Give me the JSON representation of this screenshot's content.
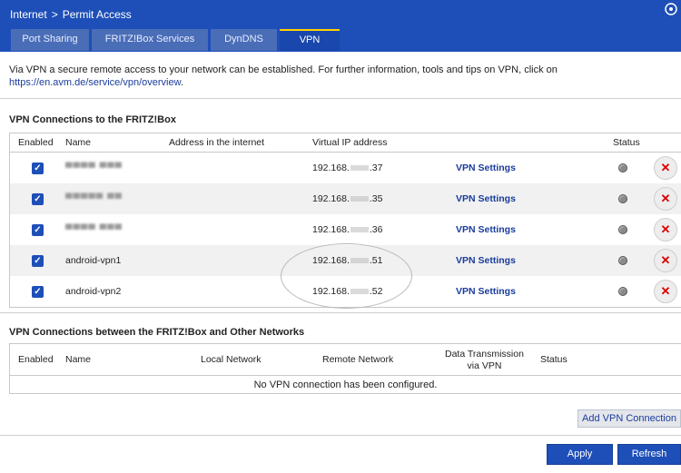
{
  "header": {
    "breadcrumb": [
      "Internet",
      ">",
      "Permit Access"
    ],
    "tabs": [
      {
        "label": "Port Sharing",
        "active": false
      },
      {
        "label": "FRITZ!Box Services",
        "active": false
      },
      {
        "label": "DynDNS",
        "active": false
      },
      {
        "label": "VPN",
        "active": true
      }
    ],
    "help_icon": "help-icon"
  },
  "intro": {
    "text_before": "Via VPN a secure remote access to your network can be established. For further information, tools and tips on VPN, click on ",
    "link": "https://en.avm.de/service/vpn/overview",
    "text_after": "."
  },
  "vpn_connections": {
    "title": "VPN Connections to the FRITZ!Box",
    "columns": {
      "enabled": "Enabled",
      "name": "Name",
      "address": "Address in the internet",
      "virtual_ip": "Virtual IP address",
      "status": "Status"
    },
    "rows": [
      {
        "enabled": true,
        "name": "",
        "ip_prefix": "192.168.",
        "ip_suffix": ".37",
        "settings": "VPN Settings"
      },
      {
        "enabled": true,
        "name": "",
        "ip_prefix": "192.168.",
        "ip_suffix": ".35",
        "settings": "VPN Settings"
      },
      {
        "enabled": true,
        "name": "",
        "ip_prefix": "192.168.",
        "ip_suffix": ".36",
        "settings": "VPN Settings"
      },
      {
        "enabled": true,
        "name": "android-vpn1",
        "ip_prefix": "192.168.",
        "ip_suffix": ".51",
        "settings": "VPN Settings"
      },
      {
        "enabled": true,
        "name": "android-vpn2",
        "ip_prefix": "192.168.",
        "ip_suffix": ".52",
        "settings": "VPN Settings"
      }
    ],
    "check_glyph": "✓",
    "delete_glyph": "✕"
  },
  "other_networks": {
    "title": "VPN Connections between the FRITZ!Box and Other Networks",
    "columns": {
      "enabled": "Enabled",
      "name": "Name",
      "local": "Local Network",
      "remote": "Remote Network",
      "data_line1": "Data Transmission",
      "data_line2": "via VPN",
      "status": "Status"
    },
    "empty_message": "No VPN connection has been configured."
  },
  "buttons": {
    "add": "Add VPN Connection",
    "apply": "Apply",
    "refresh": "Refresh"
  },
  "colors": {
    "header_blue": "#1e4fb8",
    "tab_active_indicator": "#ffd200",
    "link_blue": "#1a3c9c",
    "delete_red": "#dd0000"
  }
}
